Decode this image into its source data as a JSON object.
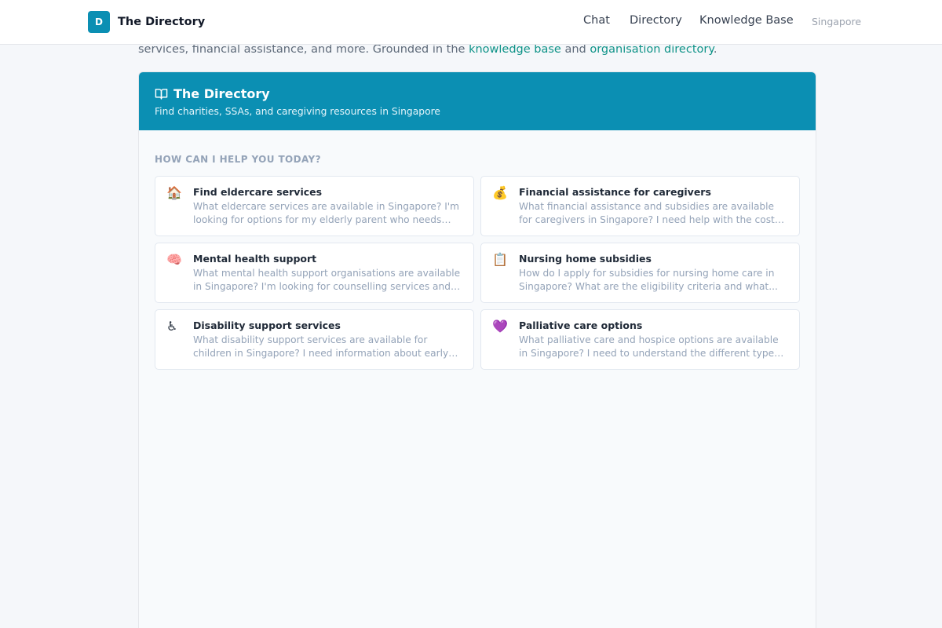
{
  "brand": {
    "logo_letter": "D",
    "name": "The Directory"
  },
  "nav": {
    "chat": "Chat",
    "directory": "Directory",
    "knowledge_base": "Knowledge Base",
    "region": "Singapore"
  },
  "intro": {
    "text_before": "services, financial assistance, and more. Grounded in the ",
    "link_kb": "knowledge base",
    "text_middle": " and ",
    "link_directory": "organisation directory",
    "text_after": "."
  },
  "card": {
    "title": "The Directory",
    "subtitle": "Find charities, SSAs, and caregiving resources in Singapore",
    "help_heading": "HOW CAN I HELP YOU TODAY?",
    "suggestions": [
      {
        "emoji": "🏠",
        "title": "Find eldercare services",
        "desc": "What eldercare services are available in Singapore? I'm looking for options for my elderly parent who needs daily..."
      },
      {
        "emoji": "💰",
        "title": "Financial assistance for caregivers",
        "desc": "What financial assistance and subsidies are available for caregivers in Singapore? I need help with the costs of carin..."
      },
      {
        "emoji": "🧠",
        "title": "Mental health support",
        "desc": "What mental health support organisations are available in Singapore? I'm looking for counselling services and suppor..."
      },
      {
        "emoji": "📋",
        "title": "Nursing home subsidies",
        "desc": "How do I apply for subsidies for nursing home care in Singapore? What are the eligibility criteria and what..."
      },
      {
        "emoji": "♿",
        "title": "Disability support services",
        "desc": "What disability support services are available for children in Singapore? I need information about early intervention,..."
      },
      {
        "emoji": "💜",
        "title": "Palliative care options",
        "desc": "What palliative care and hospice options are available in Singapore? I need to understand the different types of end..."
      }
    ]
  },
  "colors": {
    "brand_teal": "#0b8fb3",
    "link_green": "#0f9388",
    "page_bg": "#f5f7fa"
  },
  "icons": {
    "card_title_icon": "open-book-icon"
  }
}
